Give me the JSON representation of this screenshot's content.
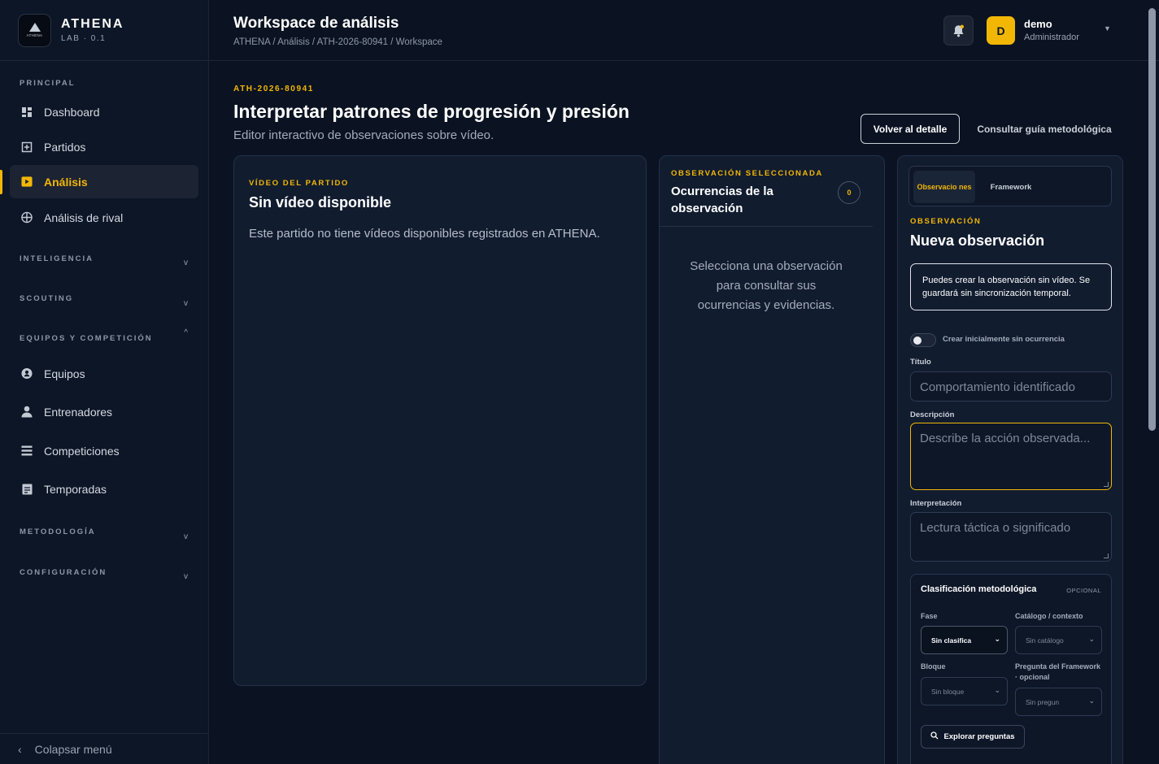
{
  "brand": {
    "name": "ATHENA",
    "sub": "LAB · 0.1",
    "logo_mini": "ATHENA"
  },
  "sidebar": {
    "sections": {
      "principal": "PRINCIPAL",
      "inteligencia": "INTELIGENCIA",
      "scouting": "SCOUTING",
      "equipos": "EQUIPOS Y COMPETICIÓN",
      "metodologia": "METODOLOGÍA",
      "configuracion": "CONFIGURACIÓN"
    },
    "items": [
      {
        "label": "Dashboard",
        "icon": "grid-icon"
      },
      {
        "label": "Partidos",
        "icon": "square-plus-icon"
      },
      {
        "label": "Análisis",
        "icon": "play-icon",
        "active": true
      },
      {
        "label": "Análisis de rival",
        "icon": "target-icon"
      },
      {
        "label": "Equipos",
        "icon": "shield-icon"
      },
      {
        "label": "Entrenadores",
        "icon": "person-icon"
      },
      {
        "label": "Competiciones",
        "icon": "list-icon"
      },
      {
        "label": "Temporadas",
        "icon": "calendar-icon"
      }
    ],
    "collapse_label": "Colapsar menú"
  },
  "header": {
    "title": "Workspace de análisis",
    "breadcrumb": "ATHENA  /  Análisis / ATH-2026-80941 / Workspace",
    "user": {
      "initial": "D",
      "name": "demo",
      "role": "Administrador"
    }
  },
  "main": {
    "ref": "ATH-2026-80941",
    "title": "Interpretar patrones de progresión y presión",
    "subtitle": "Editor interactivo de observaciones sobre vídeo.",
    "back_button": "Volver al detalle",
    "guide_button": "Consultar guía metodológica"
  },
  "video": {
    "eyebrow": "VÍDEO DEL PARTIDO",
    "title": "Sin vídeo disponible",
    "desc": "Este partido no tiene vídeos disponibles registrados en ATHENA."
  },
  "occurrences": {
    "eyebrow": "OBSERVACIÓN SELECCIONADA",
    "title": "Ocurrencias de la observación",
    "count": "0",
    "empty": "Selecciona una observación para consultar sus ocurrencias y evidencias."
  },
  "form": {
    "tabs": [
      "Observacio nes",
      "Framework"
    ],
    "eyebrow": "OBSERVACIÓN",
    "title": "Nueva observación",
    "notice": "Puedes crear la observación sin vídeo. Se guardará sin sincronización temporal.",
    "toggle_label": "Crear inicialmente sin ocurrencia",
    "titulo_label": "Título",
    "titulo_placeholder": "Comportamiento identificado",
    "descripcion_label": "Descripción",
    "descripcion_placeholder": "Describe la acción observada...",
    "interpretacion_label": "Interpretación",
    "interpretacion_placeholder": "Lectura táctica o significado",
    "clasificacion": {
      "title": "Clasificación metodológica",
      "optional": "OPCIONAL",
      "fase_label": "Fase",
      "fase_value": "Sin clasifica",
      "catalogo_label": "Catálogo / contexto",
      "catalogo_value": "Sin catálogo",
      "bloque_label": "Bloque",
      "bloque_value": "Sin bloque",
      "pregunta_label": "Pregunta del Framework · opcional",
      "pregunta_value": "Sin pregun",
      "explore_button": "Explorar preguntas"
    }
  },
  "colors": {
    "accent": "#f2b705",
    "background": "#0b1322",
    "card": "#111c2f"
  }
}
